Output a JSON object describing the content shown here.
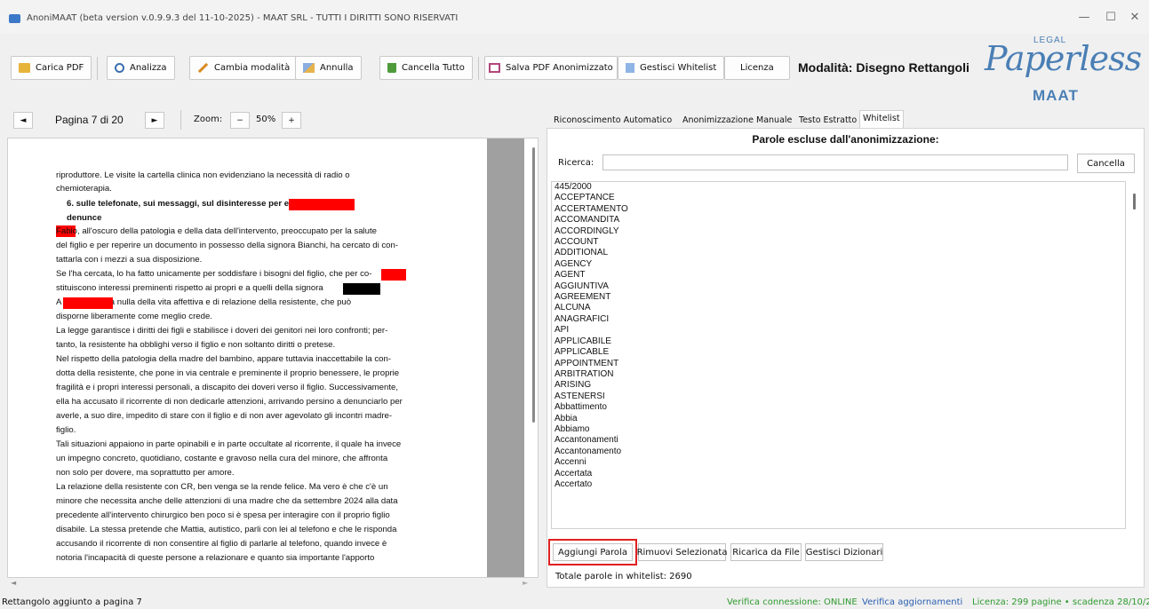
{
  "window": {
    "title": "AnoniMAAT (beta version v.0.9.9.3 del 11-10-2025) - MAAT SRL - TUTTI I DIRITTI SONO RISERVATI",
    "minimize": "—",
    "maximize": "☐",
    "close": "✕"
  },
  "toolbar": {
    "load_pdf": "Carica PDF",
    "analyze": "Analizza",
    "change_mode": "Cambia modalità",
    "undo": "Annulla",
    "clear_all": "Cancella Tutto",
    "save_pdf": "Salva PDF Anonimizzato",
    "manage_whitelist": "Gestisci Whitelist",
    "license": "Licenza",
    "mode_label": "Modalità: Disegno Rettangoli"
  },
  "logo": {
    "legal": "LEGAL",
    "main": "Paperless",
    "sub": "MAAT"
  },
  "colors": {
    "accent": "#4a7fb5",
    "redaction": "#ff0000",
    "highlight": "#e02020",
    "status_green": "#2e9a2e",
    "status_blue": "#2b5fb0"
  },
  "viewer": {
    "prev": "◄",
    "next": "►",
    "page_info": "Pagina 7 di 20",
    "zoom_label": "Zoom:",
    "zoom_out": "−",
    "zoom_value": "50%",
    "zoom_in": "+",
    "lines": [
      "riproduttore. Le visite la cartella clinica non evidenziano la necessità di radio o",
      "chemioterapia.",
      "6. sulle telefonate, sui messaggi, sul disinteresse per                          e sulle",
      "denunce",
      "          Fabio, all'oscuro della patologia e della data dell'intervento, preoccupato per la salute",
      "del figlio e per reperire un documento in possesso della signora Bianchi, ha cercato di con-",
      "tattarla con i mezzi a sua disposizione.",
      "Se l'ha cercata, lo ha fatto unicamente per soddisfare i bisogni del figlio, che per          co-",
      "stituiscono interessi preminenti rispetto ai propri e a quelli della signora",
      "A                    non interessa nulla della vita affettiva e di relazione della resistente, che può",
      "disporne liberamente come meglio crede.",
      "La legge garantisce i diritti dei figli e stabilisce i doveri dei genitori nei loro confronti; per-",
      "tanto, la resistente ha obblighi verso il figlio e non soltanto diritti o pretese.",
      "Nel rispetto della patologia della madre del bambino, appare tuttavia inaccettabile la con-",
      "dotta della resistente, che pone in via centrale e preminente il proprio benessere, le proprie",
      "fragilità e i propri interessi personali, a discapito dei doveri verso il figlio. Successivamente,",
      "ella ha accusato il ricorrente di non dedicarle attenzioni, arrivando persino a denunciarlo per",
      "averle, a suo dire, impedito di stare con il figlio e di non aver agevolato gli incontri madre-",
      "figlio.",
      "Tali situazioni appaiono in parte opinabili e in parte occultate al ricorrente, il quale ha invece",
      "un impegno concreto, quotidiano, costante e gravoso nella cura del minore, che affronta",
      "non solo per dovere, ma soprattutto per amore.",
      "La relazione della resistente con CR, ben venga se la rende felice. Ma vero è che c'è un",
      "minore che necessita anche delle attenzioni di una madre che da settembre 2024 alla data",
      "precedente all'intervento chirurgico ben poco si è spesa per interagire con il proprio figlio",
      "disabile. La stessa pretende che Mattia, autistico, parli con lei al telefono e che le risponda",
      "accusando il ricorrente di non consentire al figlio di parlarle al telefono, quando invece è",
      "notoria l'incapacità di queste persone a relazionare e quanto sia importante l'apporto"
    ]
  },
  "tabs": [
    "Riconoscimento Automatico",
    "Anonimizzazione Manuale",
    "Testo Estratto",
    "Whitelist"
  ],
  "whitelist": {
    "title": "Parole escluse dall'anonimizzazione:",
    "search_label": "Ricerca:",
    "search_value": "",
    "cancel": "Cancella",
    "items": [
      "445/2000",
      "ACCEPTANCE",
      "ACCERTAMENTO",
      "ACCOMANDITA",
      "ACCORDINGLY",
      "ACCOUNT",
      "ADDITIONAL",
      "AGENCY",
      "AGENT",
      "AGGIUNTIVA",
      "AGREEMENT",
      "ALCUNA",
      "ANAGRAFICI",
      "API",
      "APPLICABILE",
      "APPLICABLE",
      "APPOINTMENT",
      "ARBITRATION",
      "ARISING",
      "ASTENERSI",
      "Abbattimento",
      "Abbia",
      "Abbiamo",
      "Accantonamenti",
      "Accantonamento",
      "Accenni",
      "Accertata",
      "Accertato"
    ],
    "add": "Aggiungi Parola",
    "remove": "Rimuovi Selezionata",
    "reload": "Ricarica da File",
    "dictionaries": "Gestisci Dizionari",
    "total": "Totale parole in whitelist: 2690"
  },
  "status": {
    "left": "Rettangolo aggiunto a pagina 7",
    "connection": "Verifica connessione: ONLINE",
    "updates": "Verifica aggiornamenti",
    "license": "Licenza: 299 pagine • scadenza 28/10/2026"
  }
}
